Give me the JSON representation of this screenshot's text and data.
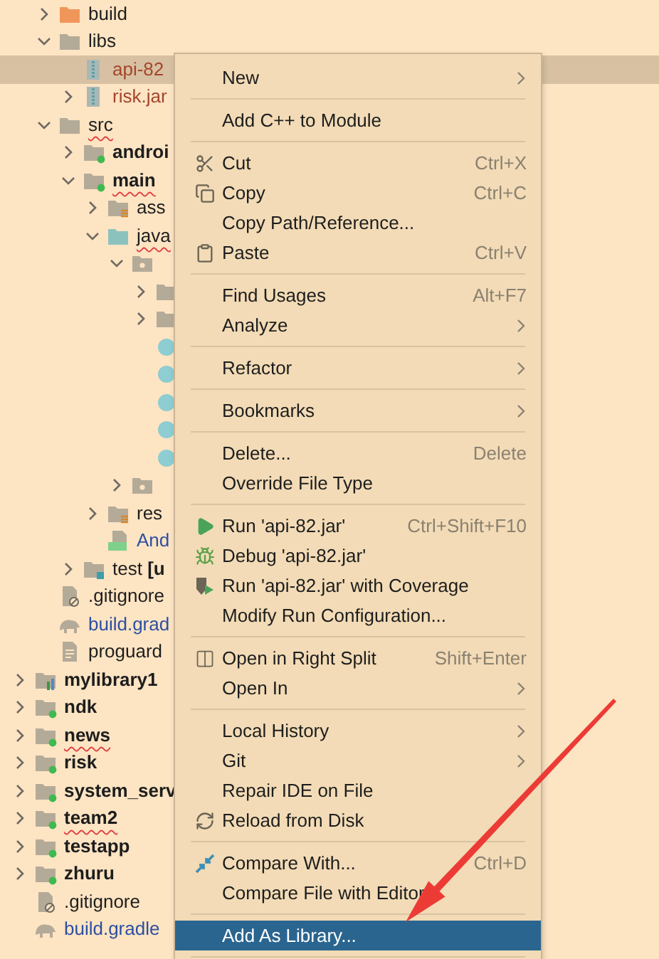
{
  "project_tree": {
    "cut_branch": [
      {
        "label": "build",
        "kind": "excluded-folder",
        "expanded": false,
        "selected": false
      },
      {
        "label": "libs",
        "kind": "folder",
        "expanded": true,
        "selected": false,
        "children": [
          {
            "label": "api-82",
            "kind": "jar",
            "selected": true,
            "color": "#a5452c"
          },
          {
            "label": "risk.jar",
            "kind": "jar",
            "expanded": false,
            "selected": false,
            "color": "#a5452c"
          }
        ]
      },
      {
        "label": "src",
        "kind": "folder",
        "expanded": true,
        "selected": false,
        "misspelled": true,
        "children": [
          {
            "label": "androi",
            "kind": "module-folder",
            "expanded": false,
            "selected": false,
            "bold": true
          },
          {
            "label": "main",
            "kind": "module-folder",
            "expanded": true,
            "selected": false,
            "bold": true,
            "misspelled": true,
            "children": [
              {
                "label": "ass",
                "kind": "resources-folder",
                "expanded": false,
                "selected": false
              },
              {
                "label": "java",
                "kind": "source-folder",
                "expanded": true,
                "selected": false,
                "misspelled": true,
                "children": [
                  {
                    "kind": "package",
                    "expanded": true,
                    "selected": false,
                    "children": [
                      {
                        "kind": "folder",
                        "expanded": false,
                        "selected": false
                      },
                      {
                        "kind": "folder",
                        "expanded": false,
                        "selected": false
                      },
                      {
                        "kind": "class",
                        "selected": false
                      },
                      {
                        "kind": "class",
                        "selected": false
                      },
                      {
                        "kind": "class",
                        "selected": false
                      },
                      {
                        "kind": "class",
                        "selected": false
                      },
                      {
                        "kind": "class",
                        "selected": false
                      }
                    ]
                  },
                  {
                    "kind": "package",
                    "expanded": false,
                    "selected": false
                  }
                ]
              },
              {
                "label": "res",
                "kind": "resources-folder",
                "expanded": false,
                "selected": false
              },
              {
                "label": "And",
                "kind": "manifest",
                "selected": false,
                "color": "#2c4fa3"
              }
            ]
          },
          {
            "label": "test **[u**",
            "kind": "test-folder",
            "expanded": false,
            "selected": false
          }
        ]
      },
      {
        "label": ".gitignore",
        "kind": "ignore-file",
        "selected": false
      },
      {
        "label": "build.grad",
        "kind": "gradle",
        "selected": false,
        "color": "#2c4fa3"
      },
      {
        "label": "proguard",
        "kind": "text-file",
        "selected": false
      }
    ],
    "items": [
      {
        "label": "mylibrary1",
        "kind": "library-module",
        "expanded": false,
        "selected": false,
        "bold": true
      },
      {
        "label": "ndk",
        "kind": "module-folder",
        "expanded": false,
        "selected": false,
        "bold": true
      },
      {
        "label": "news",
        "kind": "module-folder",
        "expanded": false,
        "selected": false,
        "bold": true,
        "misspelled": true
      },
      {
        "label": "risk",
        "kind": "module-folder",
        "expanded": false,
        "selected": false,
        "bold": true
      },
      {
        "label": "system_serv",
        "kind": "module-folder",
        "expanded": false,
        "selected": false,
        "bold": true
      },
      {
        "label": "team2",
        "kind": "module-folder",
        "expanded": false,
        "selected": false,
        "bold": true,
        "misspelled": true
      },
      {
        "label": "testapp",
        "kind": "module-folder",
        "expanded": false,
        "selected": false,
        "bold": true
      },
      {
        "label": "zhuru",
        "kind": "module-folder",
        "expanded": false,
        "selected": false,
        "bold": true
      },
      {
        "label": ".gitignore",
        "kind": "ignore-file",
        "selected": false
      },
      {
        "label": "build.gradle",
        "kind": "gradle",
        "selected": false,
        "color": "#2c4fa3"
      }
    ]
  },
  "context_menu": {
    "groups": [
      [
        {
          "label": "New",
          "submenu": true,
          "selected": false
        }
      ],
      [
        {
          "label": "Add C++ to Module",
          "submenu": false,
          "selected": false
        }
      ],
      [
        {
          "label": "Cut",
          "shortcut": "Ctrl+X",
          "kind": "scissors",
          "submenu": false,
          "selected": false
        },
        {
          "label": "Copy",
          "shortcut": "Ctrl+C",
          "kind": "copy",
          "submenu": false,
          "selected": false
        },
        {
          "label": "Copy Path/Reference...",
          "submenu": false,
          "selected": false
        },
        {
          "label": "Paste",
          "shortcut": "Ctrl+V",
          "kind": "paste",
          "submenu": false,
          "selected": false
        }
      ],
      [
        {
          "label": "Find Usages",
          "shortcut": "Alt+F7",
          "submenu": false,
          "selected": false
        },
        {
          "label": "Analyze",
          "submenu": true,
          "selected": false
        }
      ],
      [
        {
          "label": "Refactor",
          "submenu": true,
          "selected": false
        }
      ],
      [
        {
          "label": "Bookmarks",
          "submenu": true,
          "selected": false
        }
      ],
      [
        {
          "label": "Delete...",
          "shortcut": "Delete",
          "submenu": false,
          "selected": false
        },
        {
          "label": "Override File Type",
          "submenu": false,
          "selected": false
        }
      ],
      [
        {
          "label": "Run 'api-82.jar'",
          "shortcut": "Ctrl+Shift+F10",
          "kind": "run",
          "submenu": false,
          "selected": false
        },
        {
          "label": "Debug 'api-82.jar'",
          "kind": "debug",
          "submenu": false,
          "selected": false
        },
        {
          "label": "Run 'api-82.jar' with Coverage",
          "kind": "coverage",
          "submenu": false,
          "selected": false
        },
        {
          "label": "Modify Run Configuration...",
          "submenu": false,
          "selected": false
        }
      ],
      [
        {
          "label": "Open in Right Split",
          "shortcut": "Shift+Enter",
          "kind": "split",
          "submenu": false,
          "selected": false
        },
        {
          "label": "Open In",
          "submenu": true,
          "selected": false
        }
      ],
      [
        {
          "label": "Local History",
          "submenu": true,
          "selected": false
        },
        {
          "label": "Git",
          "submenu": true,
          "selected": false
        },
        {
          "label": "Repair IDE on File",
          "submenu": false,
          "selected": false
        },
        {
          "label": "Reload from Disk",
          "kind": "reload",
          "submenu": false,
          "selected": false
        }
      ],
      [
        {
          "label": "Compare With...",
          "shortcut": "Ctrl+D",
          "kind": "compare",
          "submenu": false,
          "selected": false
        },
        {
          "label": "Compare File with Editor",
          "submenu": false,
          "selected": false
        }
      ],
      [
        {
          "label": "Add As Library...",
          "submenu": false,
          "selected": true
        }
      ]
    ]
  }
}
